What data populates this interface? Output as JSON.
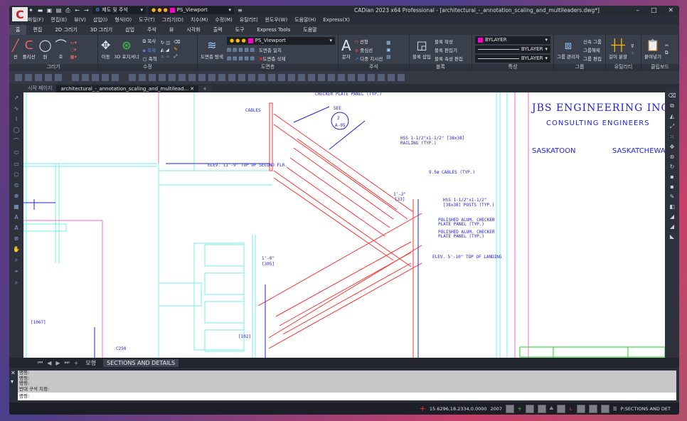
{
  "app": {
    "title": "CADian 2023 x64 Professional - [architectural_-_annotation_scaling_and_multileaders.dwg*]",
    "logo": "C"
  },
  "qat": {
    "workspace": "제도 및 주석",
    "layer": "PS_Viewport"
  },
  "menu": [
    "파일(F)",
    "편집(E)",
    "뷰(V)",
    "삽입(I)",
    "형식(O)",
    "도구(T)",
    "그리기(D)",
    "치수(M)",
    "수정(M)",
    "유틸리티",
    "윈도우(W)",
    "도움말(H)",
    "Express(X)"
  ],
  "ribbon_tabs": [
    "홈",
    "편집",
    "2D 그리기",
    "3D 그리기",
    "삽입",
    "주석",
    "뷰",
    "시각화",
    "출력",
    "도구",
    "Express Tools",
    "도움말"
  ],
  "panels": {
    "draw": {
      "label": "그리기",
      "items": [
        "선",
        "폴리선",
        "원",
        "호"
      ]
    },
    "modify": {
      "label": "수정",
      "items": [
        "이동",
        "3D 포지셔너",
        "복사",
        "회전",
        "축척"
      ]
    },
    "layer": {
      "label": "도면층",
      "explorer": "도면층 탐색",
      "layer": "PS_Viewport",
      "items": [
        "도면층 일치",
        "도면층 삭제"
      ]
    },
    "annotation": {
      "label": "주석",
      "items": [
        "문자",
        "선형",
        "중심선",
        "다중 지시선"
      ]
    },
    "block": {
      "label": "블록",
      "items": [
        "블록 삽입",
        "블록 작성",
        "블록 편집기",
        "블록 속성 편집"
      ]
    },
    "properties": {
      "label": "특성",
      "color": "BYLAYER",
      "linetype": "BYLAYER",
      "lineweight": "BYLAYER",
      "color_swatch": "#ff00cc"
    },
    "group": {
      "label": "그룹",
      "items": [
        "그룹 관리자",
        "신속 그룹",
        "그룹해제",
        "그룹 편집"
      ]
    },
    "utility": {
      "label": "유틸리티",
      "items": [
        "길이 분할"
      ]
    },
    "clipboard": {
      "label": "클립보드",
      "items": [
        "붙여넣기"
      ]
    }
  },
  "doc_tabs": [
    "시작 페이지",
    "architectural_-_annotation_scaling_and_multilead...",
    "+"
  ],
  "drawing": {
    "title_block": [
      "JBS ENGINEERING INC.",
      "CONSULTING ENGINEERS",
      "SASKATOON",
      "SASKATCHEWA"
    ],
    "notes": [
      "CHECKER PLATE PANEL (TYP.)",
      "CABLES",
      "SEE",
      "2",
      "A-05",
      "HSS 1-1/2\"x1-1/2\" [38x38]",
      "RAILING (TYP.)",
      "ELEV. 11'-9\" TOP OF SECOND FLR.",
      "9.5ø CABLES (TYP.)",
      "1'-2\"",
      "[33]",
      "HSS 1-1/2\"x1-1/2\"",
      "[38x38] POSTS (TYP.)",
      "POLISHED ALUM. CHECKER",
      "PLATE PANEL (TYP.)",
      "POLISHED ALUM. CHECKER",
      "PLATE PANEL (TYP.)",
      "ELEV. 5'-10\" TOP OF LANDING",
      "1'-0\"",
      "[305]",
      "[102]",
      "[1067]",
      "C250"
    ]
  },
  "layout_tabs": [
    "모형",
    "SECTIONS AND DETAILS"
  ],
  "command": {
    "history": [
      "명령:",
      "명령:",
      "명령:",
      "반대 구석 지정:"
    ],
    "prompt": "명령:"
  },
  "status": {
    "coords": "15.6296,18.2334,0.0000",
    "version": "2007",
    "layout": "P:SECTIONS AND DET"
  }
}
